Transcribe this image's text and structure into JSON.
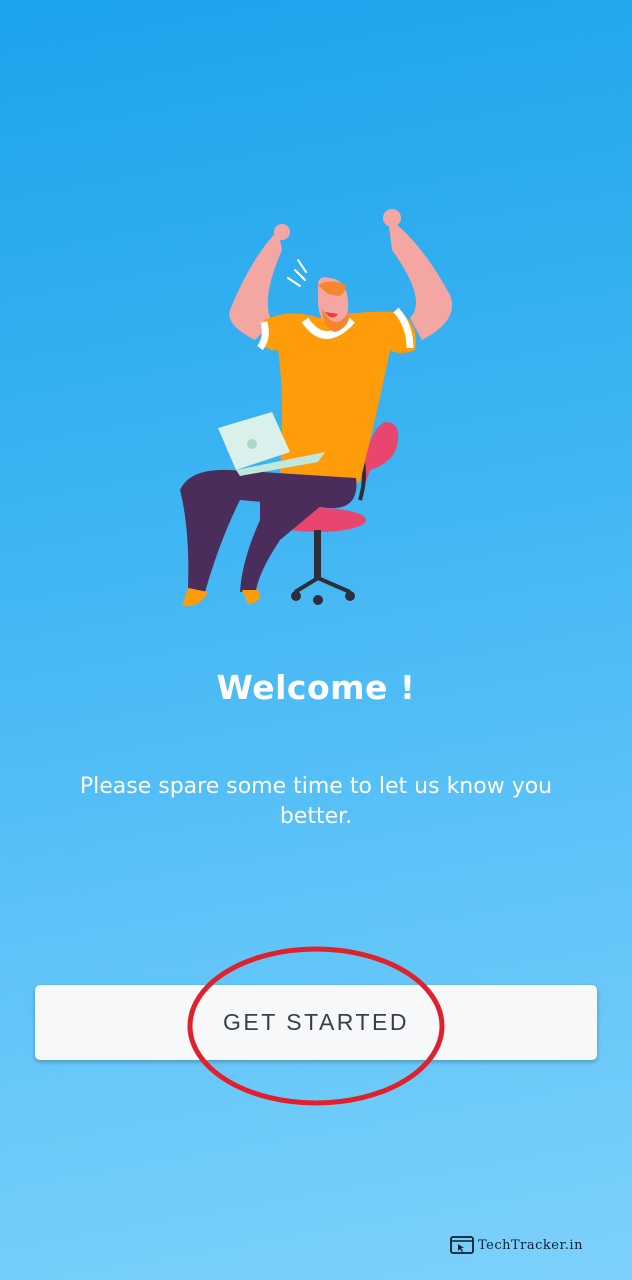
{
  "welcome": {
    "title": "Welcome !",
    "subtitle": "Please spare some time to let us know you better."
  },
  "actions": {
    "get_started_label": "GET STARTED"
  },
  "annotation": {
    "color": "#e0202a"
  },
  "watermark": {
    "text": "TechTracker.in"
  },
  "colors": {
    "background_top": "#1ba3ec",
    "background_bottom": "#7dd1fb",
    "shirt": "#ff9c0a",
    "chair": "#e8466e",
    "pants": "#4a2d5a",
    "laptop": "#d9f1ea"
  }
}
